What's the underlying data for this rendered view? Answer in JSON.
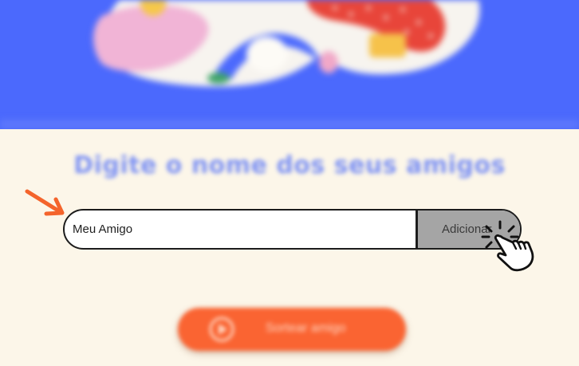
{
  "header": {
    "background_color": "#4b69fd",
    "illustration_icon": "friends-illustration-icon"
  },
  "main": {
    "title": "Digite o nome dos seus amigos",
    "input": {
      "value": "Meu Amigo"
    },
    "add_button": {
      "label": "Adicionar"
    },
    "draw_button": {
      "label": "Sortear amigo",
      "icon": "play-icon",
      "color": "#fa6432"
    }
  },
  "annotations": {
    "arrow_icon": "arrow-icon",
    "arrow_color": "#f4642c",
    "cursor_icon": "hand-pointer-click-icon"
  }
}
